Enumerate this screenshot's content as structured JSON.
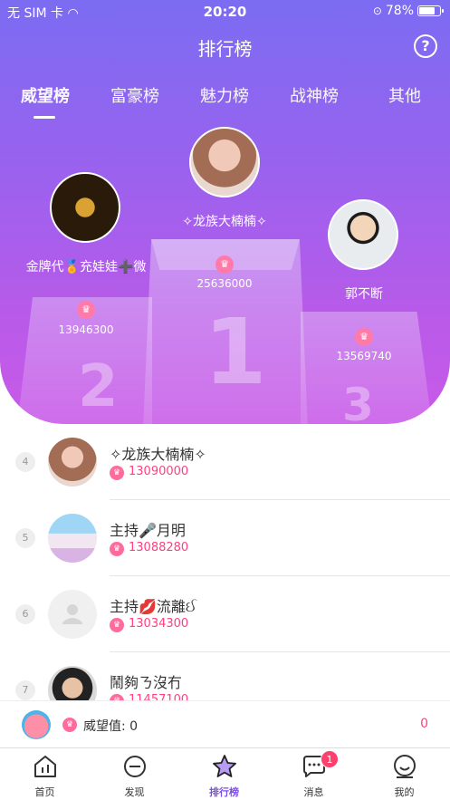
{
  "status_bar": {
    "carrier": "无 SIM 卡",
    "time": "20:20",
    "battery": "78%"
  },
  "header": {
    "title": "排行榜",
    "help_icon": "question-icon"
  },
  "tabs": [
    {
      "label": "威望榜",
      "active": true
    },
    {
      "label": "富豪榜",
      "active": false
    },
    {
      "label": "魅力榜",
      "active": false
    },
    {
      "label": "战神榜",
      "active": false
    },
    {
      "label": "其他",
      "active": false
    }
  ],
  "top3": [
    {
      "rank": "1",
      "name": "✧龙族大楠楠✧",
      "score": "25636000"
    },
    {
      "rank": "2",
      "name": "金牌代🏅充娃娃➕微",
      "score": "13946300"
    },
    {
      "rank": "3",
      "name": "郭不断",
      "score": "13569740"
    }
  ],
  "list": [
    {
      "rank": "4",
      "name": "✧龙族大楠楠✧",
      "score": "13090000"
    },
    {
      "rank": "5",
      "name": "主持🎤月明",
      "score": "13088280"
    },
    {
      "rank": "6",
      "name": "主持💋流離ઈ",
      "score": "13034300"
    },
    {
      "rank": "7",
      "name": "鬧夠ㄋ沒冇",
      "score": "11457100"
    }
  ],
  "my": {
    "label": "威望值:  0",
    "rank": "0"
  },
  "tabbar": [
    {
      "label": "首页",
      "icon": "chart-home-icon",
      "active": false
    },
    {
      "label": "发现",
      "icon": "discover-icon",
      "active": false
    },
    {
      "label": "排行榜",
      "icon": "star-icon",
      "active": true
    },
    {
      "label": "消息",
      "icon": "message-icon",
      "active": false,
      "badge": "1"
    },
    {
      "label": "我的",
      "icon": "profile-icon",
      "active": false
    }
  ],
  "colors": {
    "accent": "#7b4fe3",
    "score": "#ff3f7f",
    "gradient_top": "#7b6cf2",
    "gradient_bottom": "#c95ae8"
  }
}
